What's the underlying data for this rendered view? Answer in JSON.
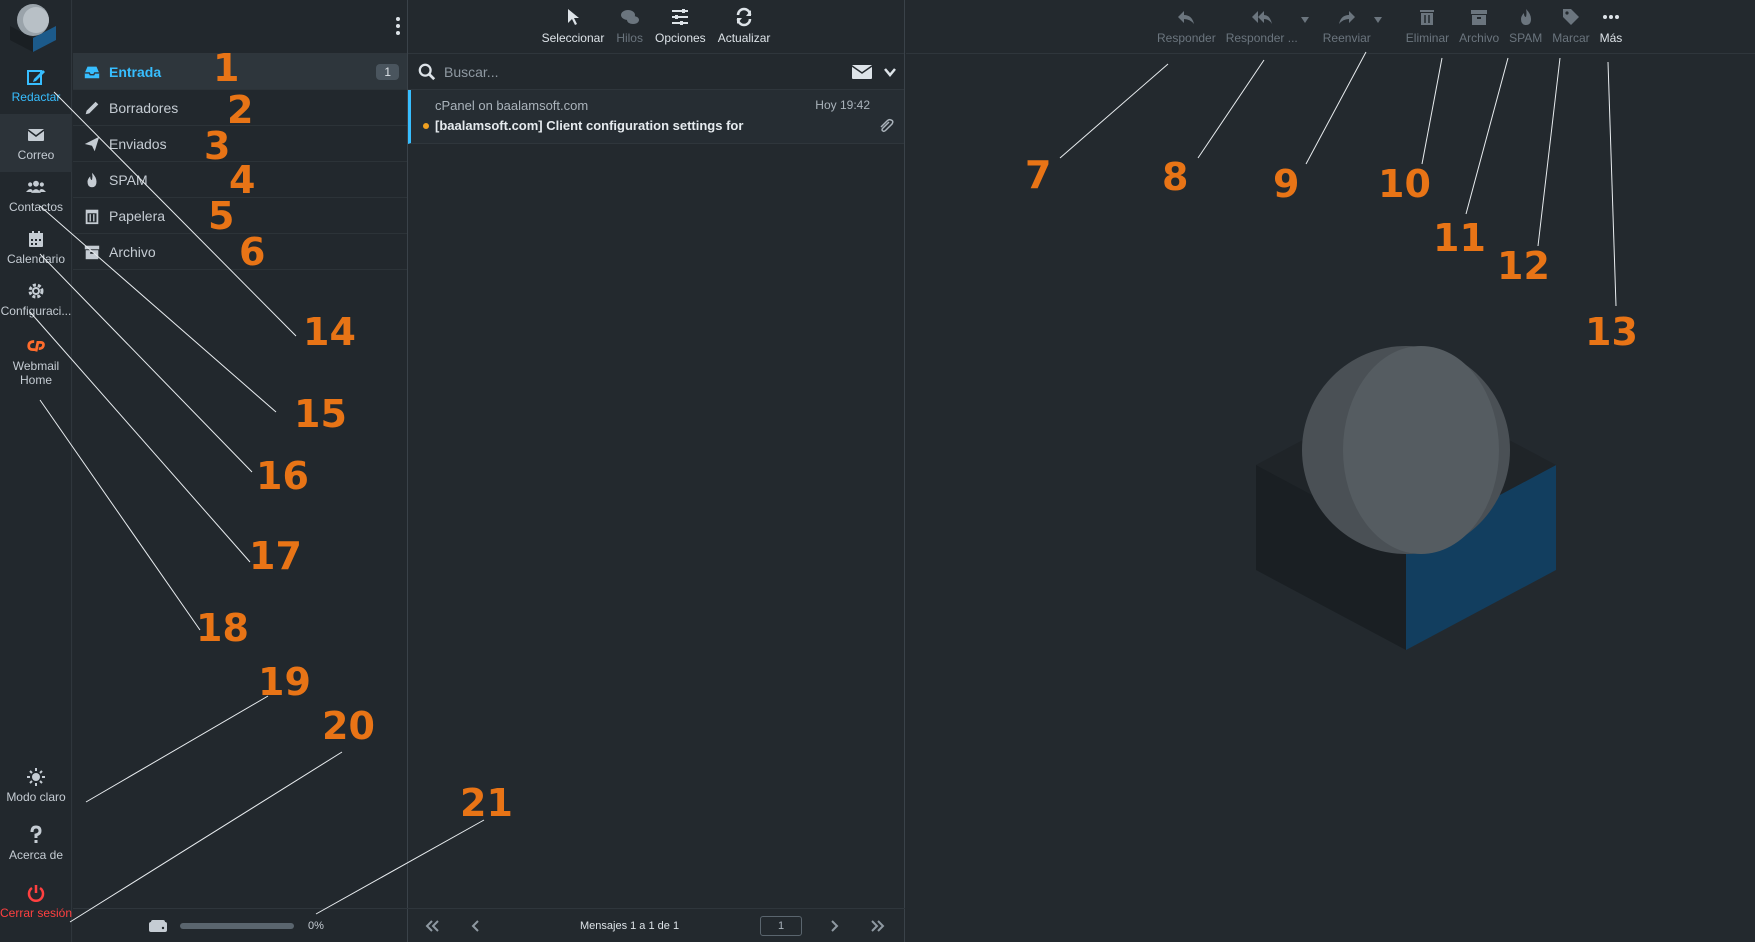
{
  "leftnav": {
    "items": [
      {
        "label": "Redactar",
        "icon": "compose-icon"
      },
      {
        "label": "Correo",
        "icon": "mail-icon"
      },
      {
        "label": "Contactos",
        "icon": "contacts-icon"
      },
      {
        "label": "Calendario",
        "icon": "calendar-icon"
      },
      {
        "label": "Configuraci...",
        "icon": "gear-icon"
      },
      {
        "label": "Webmail Home",
        "icon": "cpanel-icon"
      }
    ],
    "bottom": [
      {
        "label": "Modo claro",
        "icon": "sun-icon"
      },
      {
        "label": "Acerca de",
        "icon": "question-icon"
      },
      {
        "label": "Cerrar sesión",
        "icon": "power-icon"
      }
    ]
  },
  "folders": {
    "items": [
      {
        "label": "Entrada",
        "count": "1",
        "icon": "inbox-icon"
      },
      {
        "label": "Borradores",
        "icon": "pencil-icon"
      },
      {
        "label": "Enviados",
        "icon": "send-icon"
      },
      {
        "label": "SPAM",
        "icon": "flame-icon"
      },
      {
        "label": "Papelera",
        "icon": "trash-icon"
      },
      {
        "label": "Archivo",
        "icon": "archive-icon"
      }
    ],
    "quota_text": "0%",
    "quota_fraction": 0
  },
  "list_toolbar": {
    "select": "Seleccionar",
    "threads": "Hilos",
    "options": "Opciones",
    "refresh": "Actualizar"
  },
  "search": {
    "placeholder": "Buscar..."
  },
  "messages": [
    {
      "from": "cPanel on baalamsoft.com",
      "date": "Hoy 19:42",
      "subject": "[baalamsoft.com] Client configuration settings for",
      "unread": true,
      "attachment": true
    }
  ],
  "pager": {
    "info": "Mensajes 1 a 1 de 1",
    "page": "1"
  },
  "preview_toolbar": {
    "reply": "Responder",
    "reply_all": "Responder ...",
    "forward": "Reenviar",
    "delete": "Eliminar",
    "archive": "Archivo",
    "spam": "SPAM",
    "mark": "Marcar",
    "more": "Más"
  },
  "annotations": [
    "1",
    "2",
    "3",
    "4",
    "5",
    "6",
    "7",
    "8",
    "9",
    "10",
    "11",
    "12",
    "13",
    "14",
    "15",
    "16",
    "17",
    "18",
    "19",
    "20",
    "21"
  ],
  "colors": {
    "accent": "#37beff",
    "annotation": "#e87416",
    "logout": "#ff4040",
    "unread_dot": "#f0a020"
  }
}
